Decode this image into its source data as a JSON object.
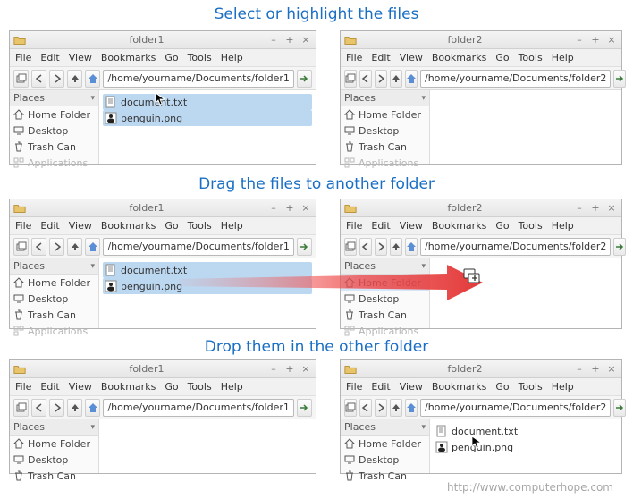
{
  "captions": {
    "step1": "Select or highlight the files",
    "step2": "Drag the files to another folder",
    "step3": "Drop them in the other folder"
  },
  "attribution": "http://www.computerhope.com",
  "menu": {
    "file": "File",
    "edit": "Edit",
    "view": "View",
    "bookmarks": "Bookmarks",
    "go": "Go",
    "tools": "Tools",
    "help": "Help"
  },
  "sidebar": {
    "header": "Places",
    "items": [
      "Home Folder",
      "Desktop",
      "Trash Can",
      "Applications"
    ]
  },
  "paths": {
    "folder1": "/home/yourname/Documents/folder1",
    "folder2": "/home/yourname/Documents/folder2"
  },
  "titles": {
    "folder1": "folder1",
    "folder2": "folder2"
  },
  "files": {
    "doc": "document.txt",
    "png": "penguin.png"
  },
  "winbtns": {
    "min": "–",
    "max": "+",
    "close": "×"
  }
}
